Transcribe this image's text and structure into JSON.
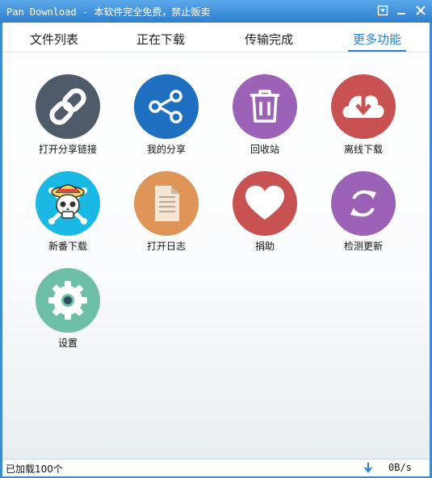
{
  "window": {
    "title": "Pan Download - 本软件完全免费，禁止贩卖"
  },
  "tabs": [
    {
      "label": "文件列表"
    },
    {
      "label": "正在下载"
    },
    {
      "label": "传输完成"
    },
    {
      "label": "更多功能"
    }
  ],
  "features": [
    {
      "label": "打开分享链接",
      "icon": "link-icon",
      "color": "#4f5a6b"
    },
    {
      "label": "我的分享",
      "icon": "share-icon",
      "color": "#1f70c1"
    },
    {
      "label": "回收站",
      "icon": "trash-icon",
      "color": "#9b62b8"
    },
    {
      "label": "离线下载",
      "icon": "cloud-download-icon",
      "color": "#c85151"
    },
    {
      "label": "新番下载",
      "icon": "skull-icon",
      "color": "#1ab9e4"
    },
    {
      "label": "打开日志",
      "icon": "document-icon",
      "color": "#e09558"
    },
    {
      "label": "捐助",
      "icon": "heart-icon",
      "color": "#c85151"
    },
    {
      "label": "检测更新",
      "icon": "refresh-icon",
      "color": "#9b62b8"
    },
    {
      "label": "设置",
      "icon": "gear-icon",
      "color": "#6dbfa6"
    }
  ],
  "status": {
    "loaded_text": "已加载100个",
    "speed": "0B/s"
  }
}
